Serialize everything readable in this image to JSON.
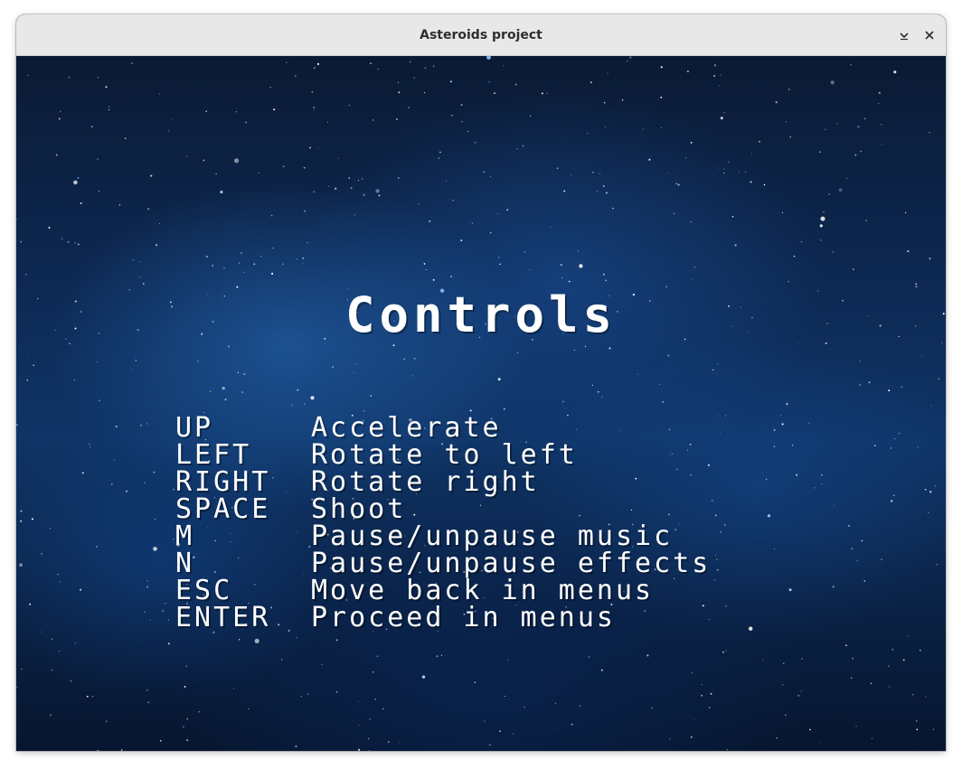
{
  "window": {
    "title": "Asteroids project",
    "minimize_icon": "chevron-down-icon",
    "close_icon": "close-icon"
  },
  "screen": {
    "heading": "Controls",
    "controls": [
      {
        "key": "UP",
        "action": "Accelerate"
      },
      {
        "key": "LEFT",
        "action": "Rotate to left"
      },
      {
        "key": "RIGHT",
        "action": "Rotate right"
      },
      {
        "key": "SPACE",
        "action": "Shoot"
      },
      {
        "key": "M",
        "action": "Pause/unpause music"
      },
      {
        "key": "N",
        "action": "Pause/unpause effects"
      },
      {
        "key": "ESC",
        "action": "Move back in menus"
      },
      {
        "key": "ENTER",
        "action": "Proceed in menus"
      }
    ]
  },
  "colors": {
    "titlebar": "#e8e8e8",
    "text": "#ffffff",
    "space_dark": "#0b1a34",
    "space_glow": "#1e6ebe"
  }
}
